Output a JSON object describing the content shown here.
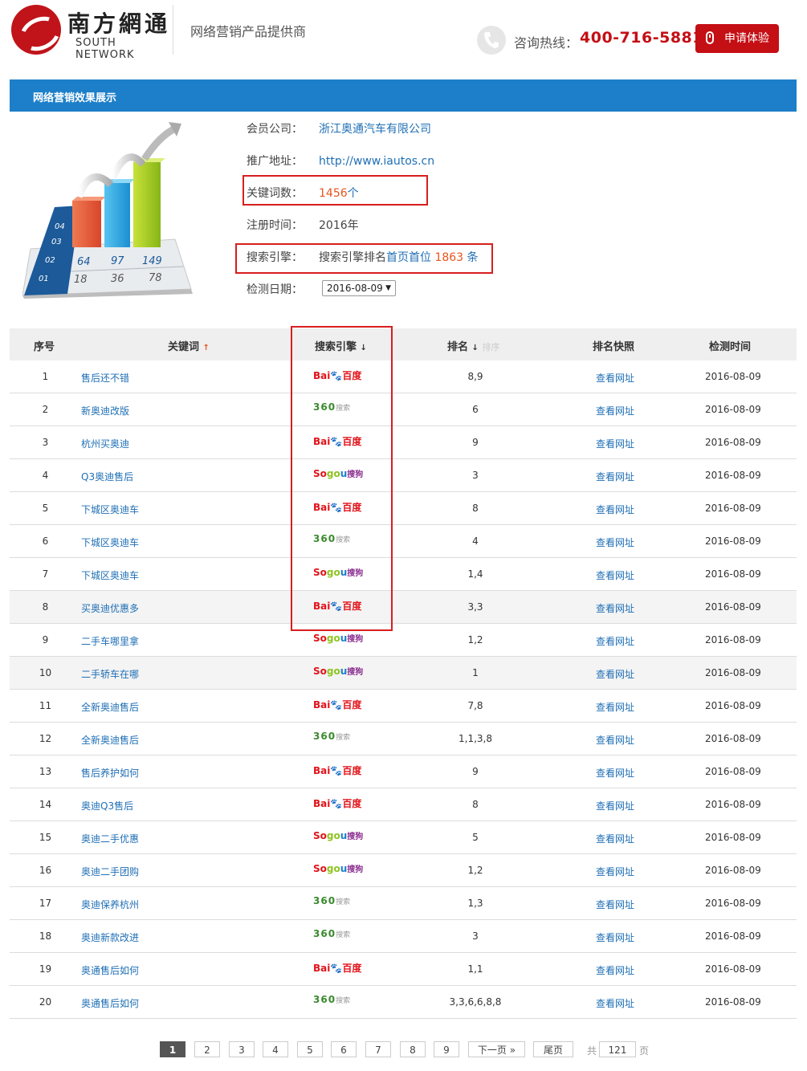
{
  "header": {
    "logo_cn": "南方網通",
    "logo_en": "SOUTH NETWORK",
    "slogan": "网络营销产品提供商",
    "hotline_label": "咨询热线：",
    "hotline_number": "400-716-5881",
    "apply_button": "申请体验"
  },
  "section_title": "网络营销效果展示",
  "illustration": {
    "levels": [
      "04",
      "03",
      "02",
      "01"
    ],
    "top_values": [
      "64",
      "97",
      "149"
    ],
    "bottom_values": [
      "18",
      "36",
      "78"
    ]
  },
  "info": {
    "company_label": "会员公司：",
    "company_value": "浙江奥通汽车有限公司",
    "url_label": "推广地址：",
    "url_value": "http://www.iautos.cn",
    "keywords_label": "关键词数：",
    "keywords_count": "1456",
    "keywords_unit": "个",
    "reg_label": "注册时间：",
    "reg_value": "2016年",
    "engine_label": "搜索引擎：",
    "engine_prefix": "搜索引擎排名",
    "engine_mid": "首页首位",
    "engine_count": "1863",
    "engine_unit": "条",
    "date_label": "检测日期：",
    "date_value": "2016-08-09"
  },
  "table": {
    "headers": {
      "no": "序号",
      "keyword": "关键词",
      "engine": "搜索引擎",
      "rank": "排名",
      "rank_sub": "排序",
      "snapshot": "排名快照",
      "time": "检测时间"
    },
    "rows": [
      {
        "no": "1",
        "keyword": "售后还不错",
        "engine": "baidu",
        "rank": "8,9",
        "snapshot": "查看网址",
        "time": "2016-08-09"
      },
      {
        "no": "2",
        "keyword": "新奥迪改版",
        "engine": "360",
        "rank": "6",
        "snapshot": "查看网址",
        "time": "2016-08-09"
      },
      {
        "no": "3",
        "keyword": "杭州买奥迪",
        "engine": "baidu",
        "rank": "9",
        "snapshot": "查看网址",
        "time": "2016-08-09"
      },
      {
        "no": "4",
        "keyword": "Q3奥迪售后",
        "engine": "sogou",
        "rank": "3",
        "snapshot": "查看网址",
        "time": "2016-08-09"
      },
      {
        "no": "5",
        "keyword": "下城区奥迪车",
        "engine": "baidu",
        "rank": "8",
        "snapshot": "查看网址",
        "time": "2016-08-09"
      },
      {
        "no": "6",
        "keyword": "下城区奥迪车",
        "engine": "360",
        "rank": "4",
        "snapshot": "查看网址",
        "time": "2016-08-09"
      },
      {
        "no": "7",
        "keyword": "下城区奥迪车",
        "engine": "sogou",
        "rank": "1,4",
        "snapshot": "查看网址",
        "time": "2016-08-09"
      },
      {
        "no": "8",
        "keyword": "买奥迪优惠多",
        "engine": "baidu",
        "rank": "3,3",
        "snapshot": "查看网址",
        "time": "2016-08-09"
      },
      {
        "no": "9",
        "keyword": "二手车哪里拿",
        "engine": "sogou",
        "rank": "1,2",
        "snapshot": "查看网址",
        "time": "2016-08-09"
      },
      {
        "no": "10",
        "keyword": "二手轿车在哪",
        "engine": "sogou",
        "rank": "1",
        "snapshot": "查看网址",
        "time": "2016-08-09"
      },
      {
        "no": "11",
        "keyword": "全新奥迪售后",
        "engine": "baidu",
        "rank": "7,8",
        "snapshot": "查看网址",
        "time": "2016-08-09"
      },
      {
        "no": "12",
        "keyword": "全新奥迪售后",
        "engine": "360",
        "rank": "1,1,3,8",
        "snapshot": "查看网址",
        "time": "2016-08-09"
      },
      {
        "no": "13",
        "keyword": "售后养护如何",
        "engine": "baidu",
        "rank": "9",
        "snapshot": "查看网址",
        "time": "2016-08-09"
      },
      {
        "no": "14",
        "keyword": "奥迪Q3售后",
        "engine": "baidu",
        "rank": "8",
        "snapshot": "查看网址",
        "time": "2016-08-09"
      },
      {
        "no": "15",
        "keyword": "奥迪二手优惠",
        "engine": "sogou",
        "rank": "5",
        "snapshot": "查看网址",
        "time": "2016-08-09"
      },
      {
        "no": "16",
        "keyword": "奥迪二手团购",
        "engine": "sogou",
        "rank": "1,2",
        "snapshot": "查看网址",
        "time": "2016-08-09"
      },
      {
        "no": "17",
        "keyword": "奥迪保养杭州",
        "engine": "360",
        "rank": "1,3",
        "snapshot": "查看网址",
        "time": "2016-08-09"
      },
      {
        "no": "18",
        "keyword": "奥迪新款改进",
        "engine": "360",
        "rank": "3",
        "snapshot": "查看网址",
        "time": "2016-08-09"
      },
      {
        "no": "19",
        "keyword": "奥通售后如何",
        "engine": "baidu",
        "rank": "1,1",
        "snapshot": "查看网址",
        "time": "2016-08-09"
      },
      {
        "no": "20",
        "keyword": "奥通售后如何",
        "engine": "360",
        "rank": "3,3,6,6,8,8",
        "snapshot": "查看网址",
        "time": "2016-08-09"
      }
    ],
    "alt_rows": [
      8,
      10
    ]
  },
  "engine_logos": {
    "baidu": {
      "part1": "Bai",
      "part2": "百度"
    },
    "360": {
      "part1": "360",
      "part2": "搜索"
    },
    "sogou": {
      "part1": "So",
      "part2": "go",
      "part3": "u",
      "part4": "搜狗"
    }
  },
  "pagination": {
    "pages": [
      "1",
      "2",
      "3",
      "4",
      "5",
      "6",
      "7",
      "8",
      "9"
    ],
    "current": "1",
    "next": "下一页 »",
    "last": "尾页",
    "total_prefix": "共",
    "total": "121",
    "total_suffix": "页"
  },
  "colors": {
    "accent_blue": "#1d7fc9",
    "brand_red": "#c40f15",
    "link_blue": "#1f6fb5",
    "highlight_orange": "#e8551d"
  }
}
